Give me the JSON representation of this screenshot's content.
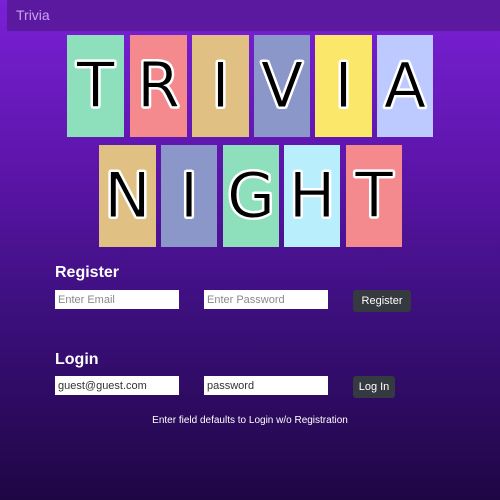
{
  "navbar": {
    "title": "Trivia"
  },
  "logo": {
    "rows": [
      {
        "tiles": [
          {
            "letter": "T",
            "color": "#8ee0bc"
          },
          {
            "letter": "R",
            "color": "#f58a8e"
          },
          {
            "letter": "I",
            "color": "#e0c083"
          },
          {
            "letter": "V",
            "color": "#8b97c9"
          },
          {
            "letter": "I",
            "color": "#fbe76a"
          },
          {
            "letter": "A",
            "color": "#bccaff"
          }
        ]
      },
      {
        "tiles": [
          {
            "letter": "N",
            "color": "#e0c083"
          },
          {
            "letter": "I",
            "color": "#8b97c9"
          },
          {
            "letter": "G",
            "color": "#8ee0bc"
          },
          {
            "letter": "H",
            "color": "#b9eefc"
          },
          {
            "letter": "T",
            "color": "#f58a8e"
          }
        ]
      }
    ]
  },
  "register": {
    "heading": "Register",
    "email_placeholder": "Enter Email",
    "password_placeholder": "Enter Password",
    "button_label": "Register"
  },
  "login": {
    "heading": "Login",
    "email_value": "guest@guest.com",
    "password_value": "password",
    "button_label": "Log In"
  },
  "hint": {
    "text": "Enter field defaults to Login w/o Registration"
  },
  "colors": {
    "navbar": "#5a199f",
    "button": "#343a40",
    "background_top": "#7a20d6",
    "background_bottom": "#1e0644"
  }
}
